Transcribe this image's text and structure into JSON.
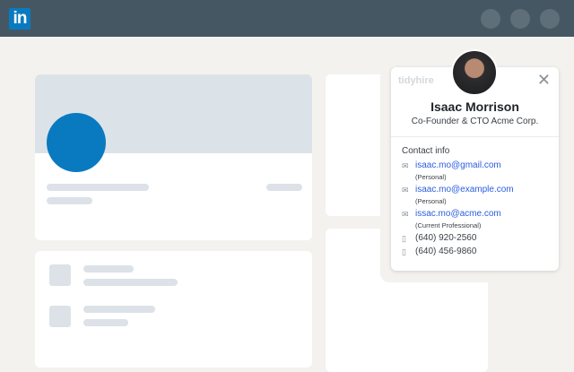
{
  "header": {
    "logo_text": "in"
  },
  "popup": {
    "brand": "tidyhire",
    "name": "Isaac Morrison",
    "title": "Co-Founder & CTO Acme Corp.",
    "contact_label": "Contact info",
    "emails": [
      {
        "address": "isaac.mo@gmail.com",
        "type": "(Personal)"
      },
      {
        "address": "isaac.mo@example.com",
        "type": "(Personal)"
      },
      {
        "address": "issac.mo@acme.com",
        "type": "(Current Professional)"
      }
    ],
    "phones": [
      "(640) 920-2560",
      "(640) 456-9860"
    ],
    "close": "✕"
  }
}
